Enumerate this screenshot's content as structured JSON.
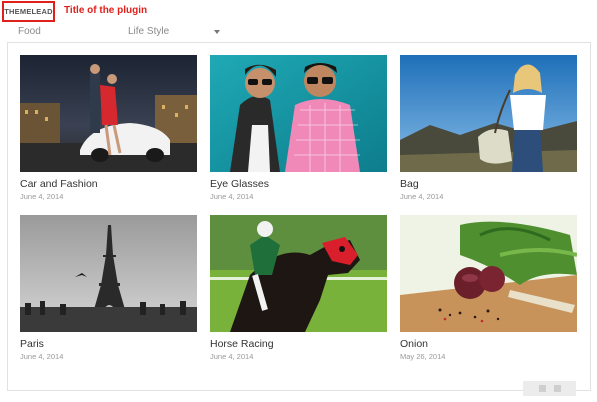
{
  "plugin": {
    "logo_text": "THEMELEAD",
    "title": "Title of the plugin"
  },
  "filters": {
    "tabs": [
      {
        "label": "Food"
      },
      {
        "label": "Life Style"
      }
    ],
    "dropdown_icon": "caret-down-icon"
  },
  "gallery": {
    "items": [
      {
        "title": "Car and Fashion",
        "date": "June 4, 2014",
        "image": "car-fashion-photo"
      },
      {
        "title": "Eye Glasses",
        "date": "June 4, 2014",
        "image": "eyeglasses-photo"
      },
      {
        "title": "Bag",
        "date": "June 4, 2014",
        "image": "bag-photo"
      },
      {
        "title": "Paris",
        "date": "June 4, 2014",
        "image": "paris-photo"
      },
      {
        "title": "Horse Racing",
        "date": "June 4, 2014",
        "image": "horse-racing-photo"
      },
      {
        "title": "Onion",
        "date": "May 26, 2014",
        "image": "onion-photo"
      }
    ]
  },
  "pagination": {
    "pages": 2
  },
  "colors": {
    "accent": "#e0201b",
    "border": "#e1e1e1",
    "date_text": "#999999"
  }
}
